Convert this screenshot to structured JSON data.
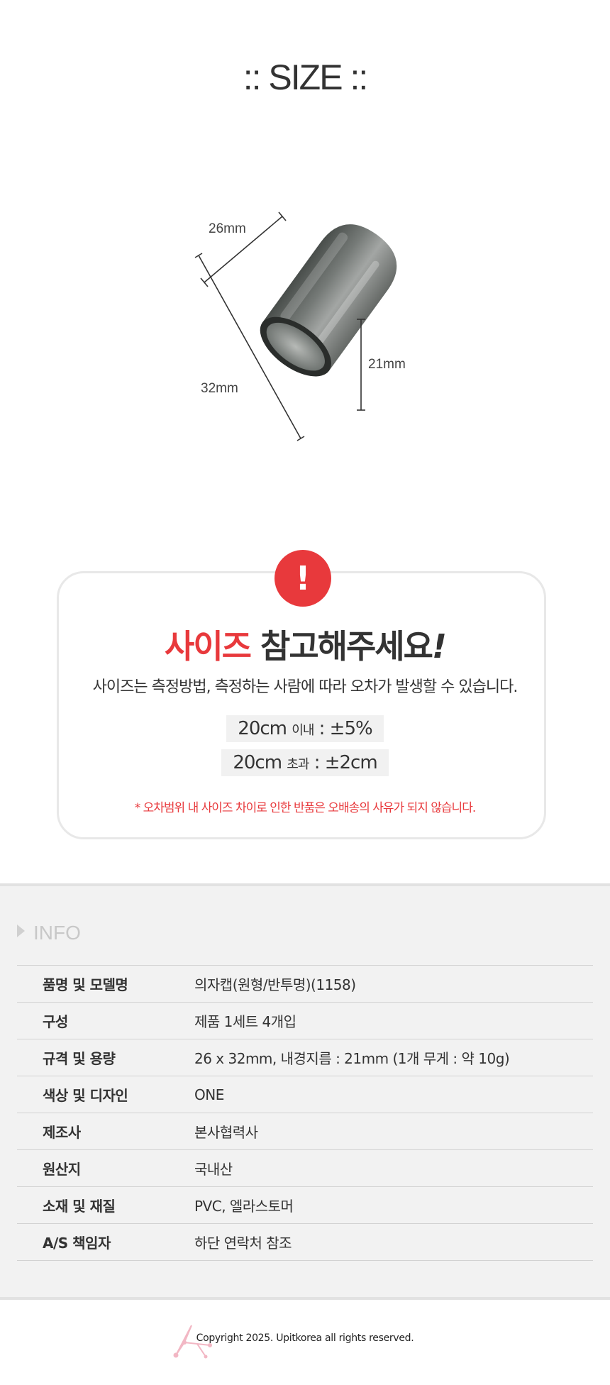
{
  "size_section": {
    "title": ":: SIZE ::",
    "dimensions": {
      "diameter": "26mm",
      "length": "32mm",
      "inner": "21mm"
    }
  },
  "notice": {
    "icon": "exclamation-icon",
    "icon_glyph": "!",
    "title_accent": "사이즈",
    "title_rest": "참고해주세요",
    "title_bang": "!",
    "description": "사이즈는 측정방법, 측정하는 사람에 따라 오차가 발생할 수 있습니다.",
    "tolerances": [
      {
        "size": "20cm",
        "condition": "이내",
        "value": ": ±5%"
      },
      {
        "size": "20cm",
        "condition": "초과",
        "value": ": ±2cm"
      }
    ],
    "warning": "* 오차범위 내 사이즈 차이로 인한 반품은 오배송의 사유가 되지 않습니다.",
    "accent_color": "#e8393c"
  },
  "info": {
    "heading": "INFO",
    "rows": [
      {
        "key": "품명 및 모델명",
        "value": "의자캡(원형/반투명)(1158)"
      },
      {
        "key": "구성",
        "value": "제품 1세트 4개입"
      },
      {
        "key": "규격 및 용량",
        "value": "26 x 32mm, 내경지름 : 21mm (1개 무게 : 약 10g)"
      },
      {
        "key": "색상 및 디자인",
        "value": "ONE"
      },
      {
        "key": "제조사",
        "value": "본사협력사"
      },
      {
        "key": "원산지",
        "value": "국내산"
      },
      {
        "key": "소재 및 재질",
        "value": "PVC, 엘라스토머"
      },
      {
        "key": "A/S 책임자",
        "value": "하단 연락처 참조"
      }
    ]
  },
  "footer": {
    "copyright": "Copyright 2025. Upitkorea all rights reserved.",
    "logo_icon": "brand-logo-icon"
  }
}
